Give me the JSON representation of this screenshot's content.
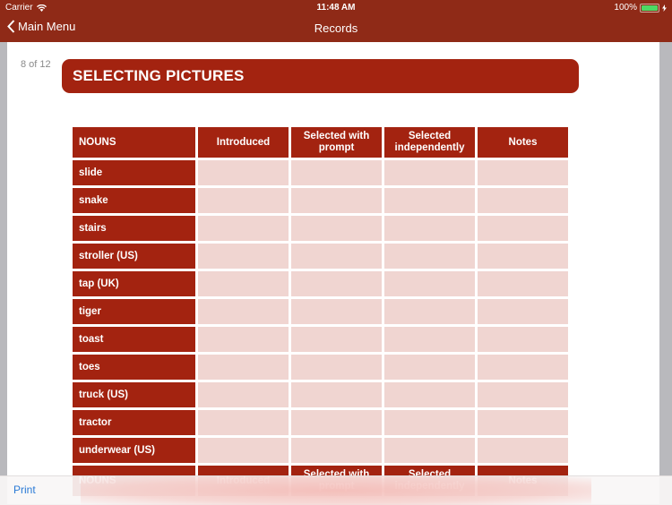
{
  "status_bar": {
    "carrier": "Carrier",
    "time": "11:48 AM",
    "battery": "100%",
    "battery_color": "#4cd964"
  },
  "nav": {
    "back_label": "Main Menu",
    "title": "Records"
  },
  "page": {
    "page_indicator": "8 of 12",
    "banner_title": "SELECTING PICTURES",
    "table": {
      "headers": [
        "NOUNS",
        "Introduced",
        "Selected with prompt",
        "Selected independently",
        "Notes"
      ],
      "rows": [
        "slide",
        "snake",
        "stairs",
        "stroller (US)",
        "tap (UK)",
        "tiger",
        "toast",
        "toes",
        "truck (US)",
        "tractor",
        "underwear (US)"
      ]
    }
  },
  "toolbar": {
    "print_label": "Print"
  },
  "colors": {
    "brand": "#8f2a17",
    "banner": "#a32310",
    "cell": "#f0d5d1",
    "link": "#2a7ad6"
  }
}
